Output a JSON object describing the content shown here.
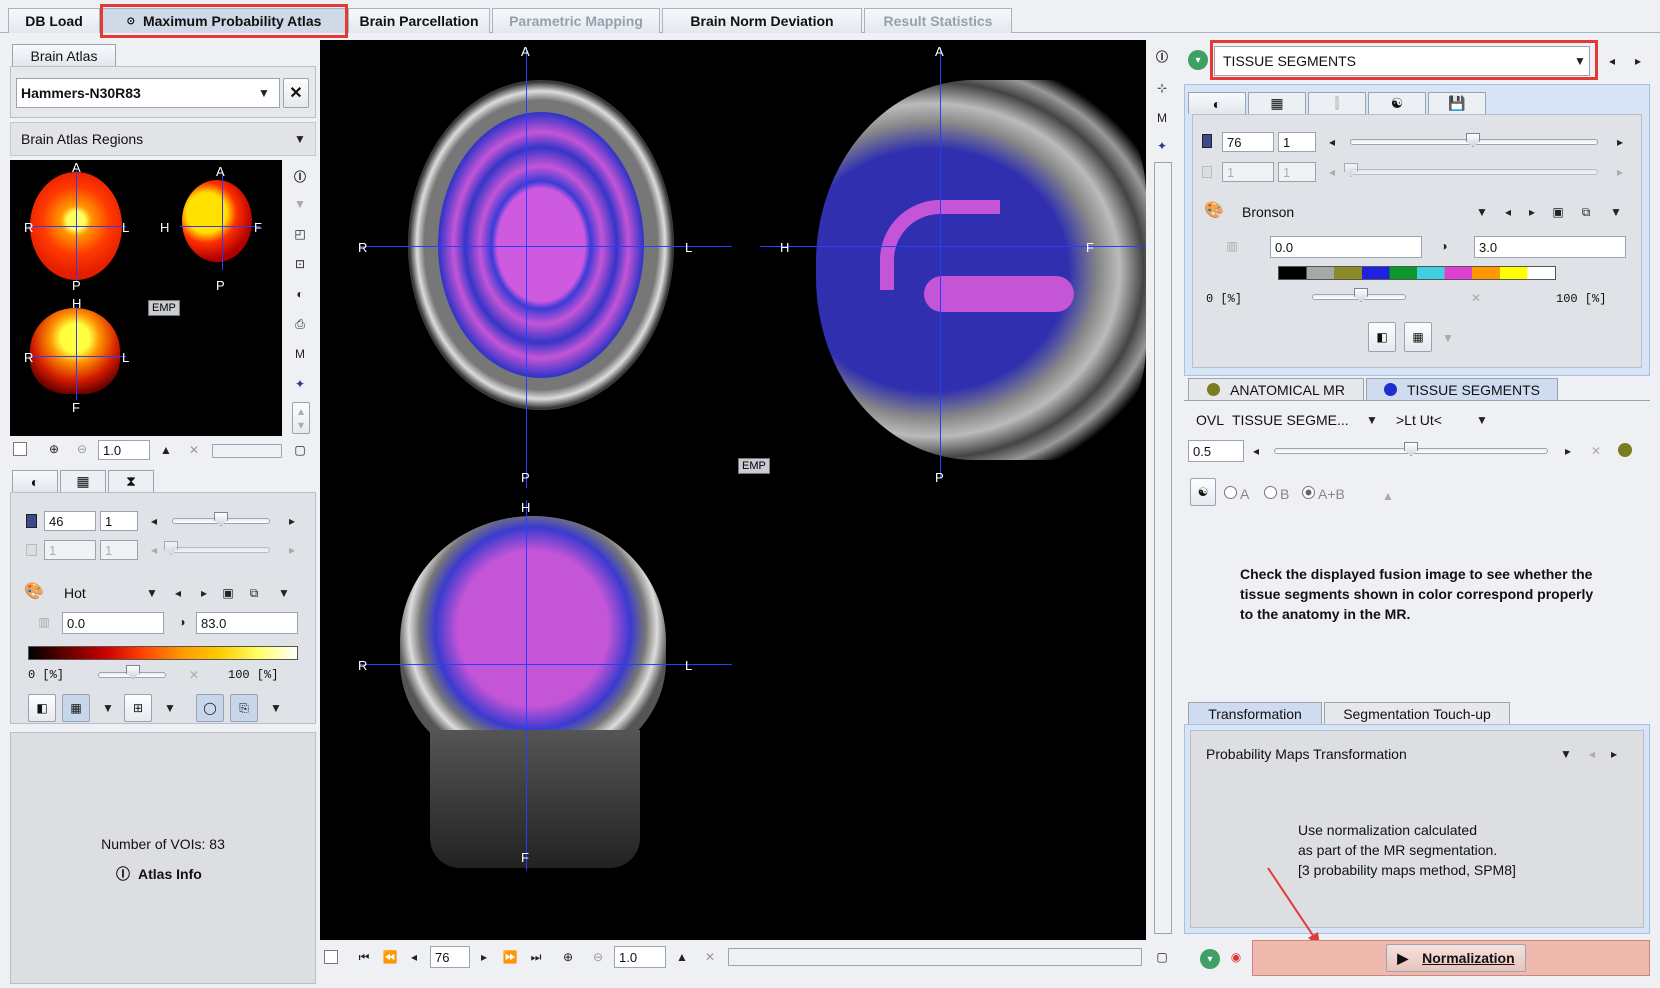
{
  "tabs": [
    {
      "label": "DB Load"
    },
    {
      "label": "Maximum Probability Atlas"
    },
    {
      "label": "Brain Parcellation"
    },
    {
      "label": "Parametric Mapping"
    },
    {
      "label": "Brain Norm Deviation"
    },
    {
      "label": "Result Statistics"
    }
  ],
  "left": {
    "atlas_tab": "Brain Atlas",
    "atlas_select": "Hammers-N30R83",
    "regions_select": "Brain Atlas Regions",
    "thumb_labels": {
      "a": "A",
      "p": "P",
      "r": "R",
      "l": "L",
      "h": "H",
      "f": "F",
      "emp": "EMP"
    },
    "zoom_value": "1.0",
    "slice_value": "46",
    "slice_step": "1",
    "slice2_value": "1",
    "slice2_step": "1",
    "colormap": "Hot",
    "min_value": "0.0",
    "max_value": "83.0",
    "pct_min": "0 [%]",
    "pct_max": "100 [%]",
    "voi_count": "Number of VOIs: 83",
    "atlas_info": "Atlas Info"
  },
  "viewer": {
    "labels": {
      "a": "A",
      "p": "P",
      "r": "R",
      "l": "L",
      "h": "H",
      "f": "F",
      "emp": "EMP"
    },
    "slice_value": "76",
    "zoom_value": "1.0"
  },
  "right": {
    "series_select": "TISSUE SEGMENTS",
    "slice_value": "76",
    "slice_step": "1",
    "slice2_value": "1",
    "slice2_step": "1",
    "colormap": "Bronson",
    "min_value": "0.0",
    "max_value": "3.0",
    "pct_min": "0 [%]",
    "pct_max": "100 [%]",
    "layer_tab_1": "ANATOMICAL MR",
    "layer_tab_2": "TISSUE SEGMENTS",
    "ovl_label": "OVL",
    "ovl_select": "TISSUE SEGME...",
    "ovl_mode": ">Lt Ut<",
    "opacity_value": "0.5",
    "radio_a": "A",
    "radio_b": "B",
    "radio_ab": "A+B",
    "instruction": "Check the displayed fusion image to see whether the tissue segments shown in color correspond properly to the anatomy in the MR.",
    "bottom_tab_1": "Transformation",
    "bottom_tab_2": "Segmentation Touch-up",
    "transform_select": "Probability Maps Transformation",
    "desc_1": "Use normalization calculated",
    "desc_2": "as part of the MR segmentation.",
    "desc_3": "[3 probability maps method, SPM8]",
    "normalization_button": "Normalization"
  },
  "colors": {
    "accent_red": "#e53935",
    "overlay_purple": "#c455d6",
    "overlay_blue": "#3a3ad0",
    "button_highlight": "#f0b9ae"
  }
}
